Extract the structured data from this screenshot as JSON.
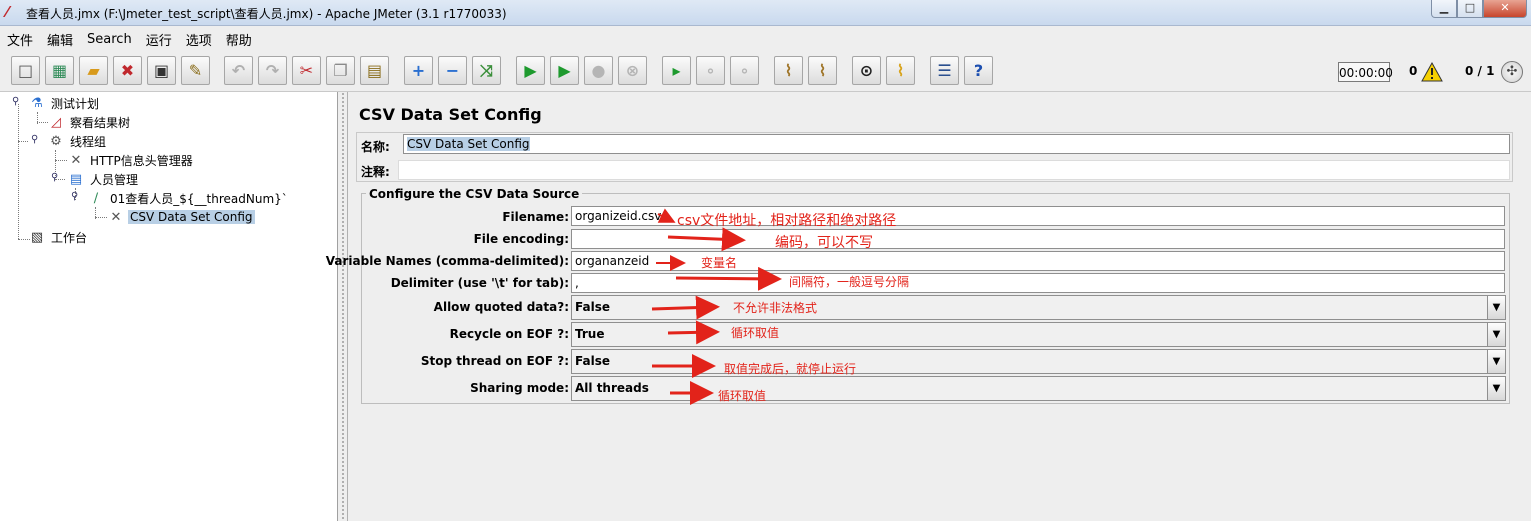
{
  "window": {
    "title": "查看人员.jmx (F:\\Jmeter_test_script\\查看人员.jmx) - Apache JMeter (3.1 r1770033)",
    "minimize": "▁",
    "maximize": "□",
    "close": "✕"
  },
  "menu": [
    "文件",
    "编辑",
    "Search",
    "运行",
    "选项",
    "帮助"
  ],
  "toolbar": {
    "buttons": [
      {
        "name": "new-icon",
        "glyph": "□",
        "color": "#555555"
      },
      {
        "name": "templates-icon",
        "glyph": "▦",
        "color": "#2e8b57"
      },
      {
        "name": "open-icon",
        "glyph": "▰",
        "color": "#d89a1c"
      },
      {
        "name": "close-file-icon",
        "glyph": "✖",
        "color": "#c0282d"
      },
      {
        "name": "save-icon",
        "glyph": "▣",
        "color": "#333333"
      },
      {
        "name": "save-as-icon",
        "glyph": "✎",
        "color": "#8a6d1a"
      },
      {
        "name": "undo-icon",
        "glyph": "↶",
        "color": "#b0b0b0"
      },
      {
        "name": "redo-icon",
        "glyph": "↷",
        "color": "#b0b0b0"
      },
      {
        "name": "cut-icon",
        "glyph": "✂",
        "color": "#c0282d"
      },
      {
        "name": "copy-icon",
        "glyph": "❐",
        "color": "#8a8a8a"
      },
      {
        "name": "paste-icon",
        "glyph": "▤",
        "color": "#8a6d1a"
      },
      {
        "name": "expand-icon",
        "glyph": "+",
        "color": "#2a6fd0"
      },
      {
        "name": "collapse-icon",
        "glyph": "−",
        "color": "#2a6fd0"
      },
      {
        "name": "toggle-icon",
        "glyph": "⤨",
        "color": "#3b8f3b"
      },
      {
        "name": "start-icon",
        "glyph": "▶",
        "color": "#1e9a2e"
      },
      {
        "name": "start-no-pauses-icon",
        "glyph": "▶",
        "color": "#1e9a2e"
      },
      {
        "name": "stop-icon",
        "glyph": "●",
        "color": "#b5b5b5"
      },
      {
        "name": "shutdown-icon",
        "glyph": "⊗",
        "color": "#b5b5b5"
      },
      {
        "name": "remote-start-icon",
        "glyph": "▸",
        "color": "#1e9a2e"
      },
      {
        "name": "remote-stop-icon",
        "glyph": "∘",
        "color": "#b5b5b5"
      },
      {
        "name": "remote-shutdown-icon",
        "glyph": "∘",
        "color": "#b5b5b5"
      },
      {
        "name": "clear-icon",
        "glyph": "⌇",
        "color": "#a0762a"
      },
      {
        "name": "clear-all-icon",
        "glyph": "⌇",
        "color": "#a0762a"
      },
      {
        "name": "search-icon",
        "glyph": "⊙",
        "color": "#222222"
      },
      {
        "name": "reset-search-icon",
        "glyph": "⌇",
        "color": "#d8a31c"
      },
      {
        "name": "function-helper-icon",
        "glyph": "☰",
        "color": "#2a4f8f"
      },
      {
        "name": "help-icon",
        "glyph": "?",
        "color": "#1d4fb0"
      }
    ],
    "timer": "00:00:00",
    "error_count": "0",
    "thread_count": "0 / 1"
  },
  "tree": [
    {
      "label": "测试计划",
      "icon": "⚗",
      "color": "#2a6fd0"
    },
    {
      "label": "察看结果树",
      "icon": "◿",
      "color": "#c0282d"
    },
    {
      "label": "线程组",
      "icon": "⚙",
      "color": "#555555"
    },
    {
      "label": "HTTP信息头管理器",
      "icon": "✕",
      "color": "#555555"
    },
    {
      "label": "人员管理",
      "icon": "▤",
      "color": "#2a6fd0"
    },
    {
      "label": "01查看人员_${__threadNum}`",
      "icon": "∕",
      "color": "#2e8b57"
    },
    {
      "label": "CSV Data Set Config",
      "icon": "✕",
      "color": "#555555"
    },
    {
      "label": "工作台",
      "icon": "▧",
      "color": "#333333"
    }
  ],
  "panel": {
    "title": "CSV Data Set Config",
    "name_label": "名称:",
    "name_value": "CSV Data Set Config",
    "comment_label": "注释:",
    "comment_value": "",
    "group_title": "Configure the CSV Data Source",
    "filename_label": "Filename:",
    "filename_value": "organizeid.csv",
    "encoding_label": "File encoding:",
    "encoding_value": "",
    "varnames_label": "Variable Names (comma-delimited):",
    "varnames_value": "organanzeid",
    "delimiter_label": "Delimiter (use '\\t' for tab):",
    "delimiter_value": ",",
    "quoted_label": "Allow quoted data?:",
    "quoted_value": "False",
    "recycle_label": "Recycle on EOF ?:",
    "recycle_value": "True",
    "stopthread_label": "Stop thread on EOF ?:",
    "stopthread_value": "False",
    "sharing_label": "Sharing mode:",
    "sharing_value": "All threads"
  },
  "annotations": {
    "filename": "csv文件地址，相对路径和绝对路径",
    "encoding": "编码，可以不写",
    "varnames": "变量名",
    "delimiter": "间隔符，一般逗号分隔",
    "quoted": "不允许非法格式",
    "recycle": "循环取值",
    "stopthread": "取值完成后，就停止运行",
    "sharing": "循环取值"
  },
  "colors": {
    "annotation": "#e2231a",
    "selection": "#b8cfe5"
  }
}
